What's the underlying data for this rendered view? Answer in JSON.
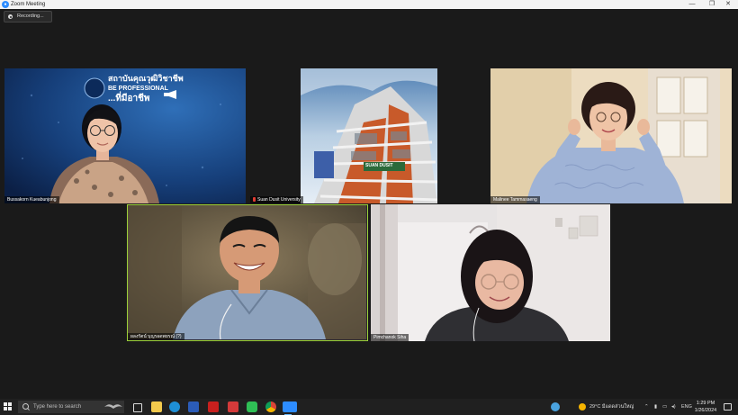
{
  "window": {
    "title": "Zoom Meeting",
    "controls": {
      "minimize": "—",
      "maximize": "❐",
      "close": "✕"
    }
  },
  "recording": {
    "label": "Recording..."
  },
  "participants": [
    {
      "name": "Bussakorn Kueabunjong",
      "banner_line1": "สถาบันคุณวุฒิวิชาชีพ",
      "banner_line2": "BE PROFESSIONAL",
      "banner_line3": "...ที่มีอาชีพ"
    },
    {
      "name": "Suan Dusit University",
      "building_sign": "SUAN DUSIT"
    },
    {
      "name": "Malinee Tammasaeng"
    },
    {
      "name": "ผลงรัตน์ บุญรอดพยรณ์ (?)",
      "active_speaker": true
    },
    {
      "name": "Pimchanok Siha"
    }
  ],
  "taskbar": {
    "search_placeholder": "Type here to search",
    "weather": "29°C  มีแดดส่วนใหญ่",
    "language": "ENG",
    "time": "1:29 PM",
    "date": "1/26/2024",
    "apps": [
      "task-view",
      "file-explorer",
      "edge",
      "word",
      "acrobat",
      "photo-app",
      "line",
      "chrome",
      "zoom"
    ]
  }
}
